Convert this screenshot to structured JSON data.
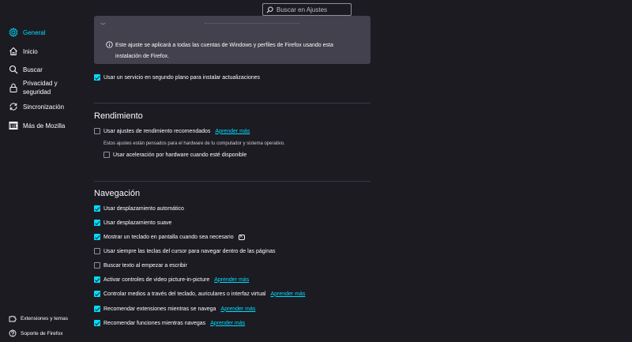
{
  "search": {
    "placeholder": "Buscar en Ajustes"
  },
  "sidebar": {
    "items": [
      {
        "label": "General",
        "icon": "gear-icon",
        "active": true
      },
      {
        "label": "Inicio",
        "icon": "home-icon"
      },
      {
        "label": "Buscar",
        "icon": "search-icon"
      },
      {
        "label": "Privacidad y seguridad",
        "line1": "Privacidad y",
        "line2": "seguridad",
        "icon": "lock-icon"
      },
      {
        "label": "Sincronización",
        "icon": "sync-icon"
      },
      {
        "label": "Más de Mozilla",
        "icon": "mozilla-icon"
      }
    ],
    "footer": [
      {
        "label": "Extensiones y temas",
        "icon": "puzzle-icon"
      },
      {
        "label": "Soporte de Firefox",
        "icon": "help-icon"
      }
    ]
  },
  "updates": {
    "info_text": "Este ajuste se aplicará a todas las cuentas de Windows y perfiles de Firefox usando esta instalación de Firefox.",
    "background_service": "Usar un servicio en segundo plano para instalar actualizaciones"
  },
  "performance": {
    "title": "Rendimiento",
    "recommended": "Usar ajustes de rendimiento recomendados",
    "learn_more": "Aprender más",
    "recommended_desc": "Estos ajustes están pensados para el hardware de tu computador y sistema operativo.",
    "hw_accel": "Usar aceleración por hardware cuando esté disponible"
  },
  "navigation": {
    "title": "Navegación",
    "items": [
      {
        "label": "Usar desplazamiento automático",
        "checked": true,
        "link": ""
      },
      {
        "label": "Usar desplazamiento suave",
        "checked": true,
        "link": ""
      },
      {
        "label": "Mostrar un teclado en pantalla cuando sea necesario",
        "checked": true,
        "link": "",
        "kbd": "K"
      },
      {
        "label": "Usar siempre las teclas del cursor para navegar dentro de las páginas",
        "checked": false,
        "link": ""
      },
      {
        "label": "Buscar texto al empezar a escribir",
        "checked": false,
        "link": ""
      },
      {
        "label": "Activar controles de video picture-in-picture",
        "checked": true,
        "link": "Aprender más"
      },
      {
        "label": "Controlar medios a través del teclado, auriculares o interfaz virtual",
        "checked": true,
        "link": "Aprender más"
      },
      {
        "label": "Recomendar extensiones mientras se navega",
        "checked": true,
        "link": "Aprender más"
      },
      {
        "label": "Recomendar funciones mientras navegas",
        "checked": true,
        "link": "Aprender más"
      }
    ]
  },
  "colors": {
    "accent": "#00ddff",
    "background": "#1c1b22",
    "panel": "#42414d"
  }
}
